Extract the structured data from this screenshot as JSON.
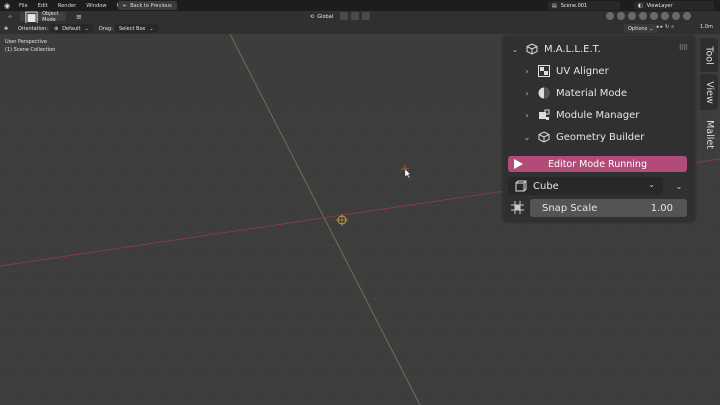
{
  "topbar": {
    "menus": [
      "File",
      "Edit",
      "Render",
      "Window",
      "Help"
    ],
    "back_button": "Back to Previous",
    "scene": "Scene.001",
    "view_layer": "ViewLayer"
  },
  "header": {
    "mode": "Object Mode",
    "orientation_transform": "Global",
    "options": "Options",
    "zoom": "1.0m"
  },
  "header2": {
    "orientation_label": "Orientation:",
    "orientation_value": "Default",
    "drag_label": "Drag:",
    "drag_value": "Select Box"
  },
  "viewport": {
    "perspective": "User Perspective",
    "collection": "(1) Scene Collection"
  },
  "panel": {
    "title": "M.A.L.L.E.T.",
    "items": [
      {
        "label": "UV Aligner",
        "icon": "checker-icon"
      },
      {
        "label": "Material Mode",
        "icon": "material-sphere-icon"
      },
      {
        "label": "Module Manager",
        "icon": "module-icon"
      },
      {
        "label": "Geometry Builder",
        "icon": "cube-mesh-icon",
        "expanded": true
      }
    ],
    "run_button": "Editor Mode Running",
    "geometry": "Cube",
    "snap_label": "Snap Scale",
    "snap_value": "1.00",
    "accent": "#b14b78"
  },
  "tabs": [
    "Tool",
    "View",
    "Mallet"
  ]
}
